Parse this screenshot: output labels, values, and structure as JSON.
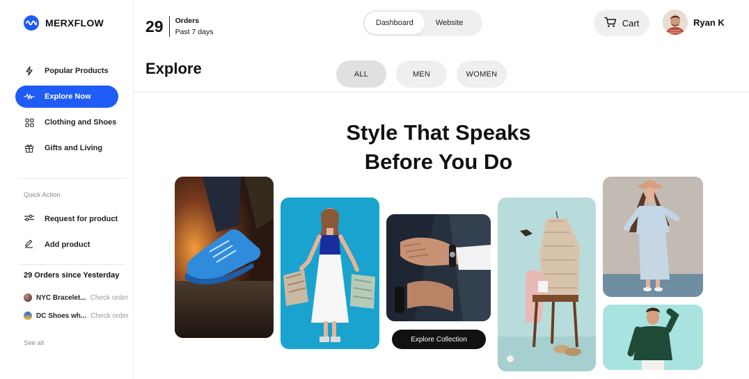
{
  "brand": {
    "name": "MERXFLOW",
    "color": "#1f5cf5"
  },
  "sidebar": {
    "nav": [
      {
        "label": "Popular Products",
        "icon": "lightning-icon"
      },
      {
        "label": "Explore Now",
        "icon": "pulse-icon",
        "active": true
      },
      {
        "label": "Clothing and Shoes",
        "icon": "grid-icon"
      },
      {
        "label": "Gifts and Living",
        "icon": "gift-icon"
      }
    ],
    "quick_action_label": "Quick Action",
    "quick_actions": [
      {
        "label": "Request for product",
        "icon": "sliders-icon"
      },
      {
        "label": "Add product",
        "icon": "pencil-icon"
      }
    ],
    "orders_heading": "29 Orders since Yesterday",
    "recent_orders": [
      {
        "name": "NYC Bracelet...",
        "link": "Check order"
      },
      {
        "name": "DC Shoes wh...",
        "link": "Check order"
      }
    ],
    "see_all": "See all"
  },
  "topbar": {
    "orders_count": "29",
    "orders_label": "Orders",
    "orders_period": "Past 7 days",
    "toggle": [
      {
        "label": "Dashboard",
        "active": true
      },
      {
        "label": "Website",
        "active": false
      }
    ],
    "cart_label": "Cart",
    "user_name": "Ryan K"
  },
  "page": {
    "title": "Explore",
    "filters": [
      {
        "label": "ALL",
        "active": true
      },
      {
        "label": "MEN",
        "active": false
      },
      {
        "label": "WOMEN",
        "active": false
      }
    ],
    "hero_line1": "Style That Speaks",
    "hero_line2": "Before You Do",
    "cta_label": "Explore Collection"
  }
}
